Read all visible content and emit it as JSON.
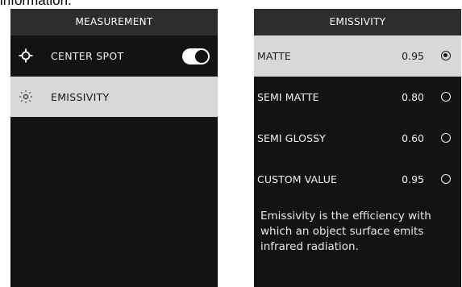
{
  "partial_text": "information.",
  "measurement": {
    "title": "MEASUREMENT",
    "items": [
      {
        "label": "CENTER SPOT",
        "icon": "crosshair-icon",
        "toggle_on": true
      },
      {
        "label": "EMISSIVITY",
        "icon": "emissivity-icon"
      }
    ]
  },
  "emissivity": {
    "title": "EMISSIVITY",
    "options": [
      {
        "label": "MATTE",
        "value": "0.95",
        "selected": true
      },
      {
        "label": "SEMI MATTE",
        "value": "0.80",
        "selected": false
      },
      {
        "label": "SEMI GLOSSY",
        "value": "0.60",
        "selected": false
      },
      {
        "label": "CUSTOM VALUE",
        "value": "0.95",
        "selected": false
      }
    ],
    "description": "Emissivity is the efficiency with which an object surface emits infrared radiation."
  },
  "colors": {
    "screen_bg": "#141313",
    "header_bg": "#2e2d2d",
    "selected_row_bg": "#d9d8d8"
  }
}
